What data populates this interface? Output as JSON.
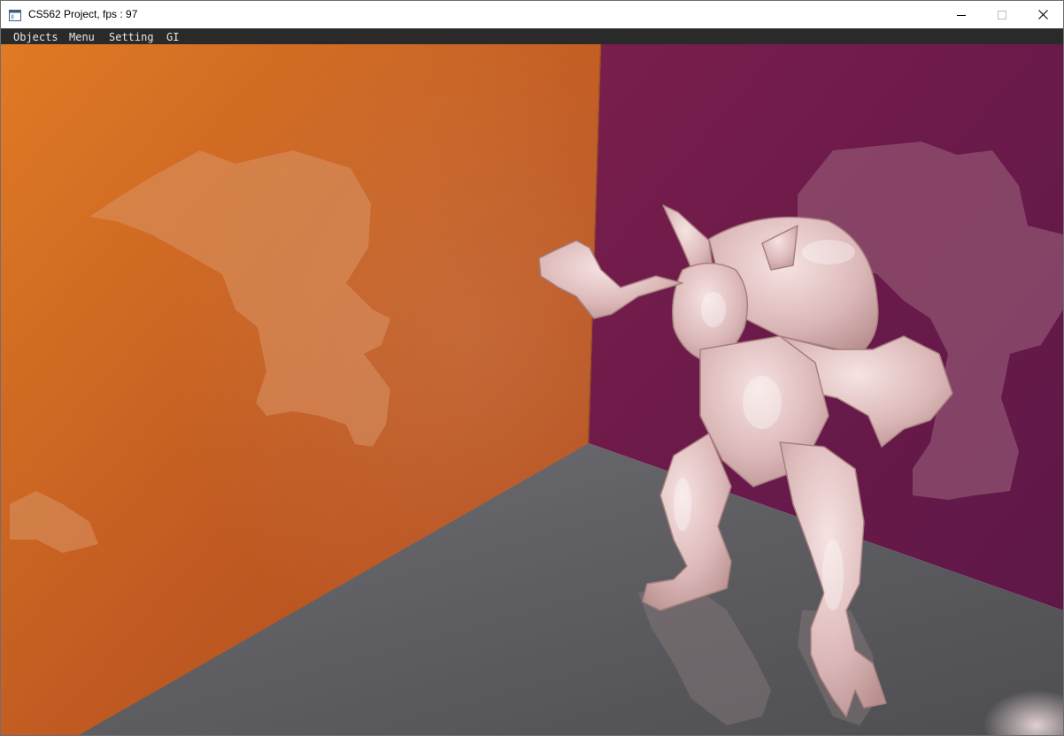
{
  "window": {
    "title": "CS562 Project, fps : 97",
    "app_icon": "window-app-icon",
    "controls": {
      "minimize_icon": "minimize-icon",
      "maximize_icon": "maximize-icon",
      "close_icon": "close-icon"
    }
  },
  "menubar": {
    "items": [
      {
        "label": "Objects"
      },
      {
        "label": "Menu"
      },
      {
        "label": "Setting"
      },
      {
        "label": "GI"
      }
    ]
  },
  "scene": {
    "colors": {
      "left_wall": "#c8641e",
      "right_wall": "#6e1e50",
      "floor": "#5c5c60",
      "model": "#e6c4c4",
      "shadow_left": "#d08a60",
      "shadow_right": "#8a5470"
    }
  }
}
